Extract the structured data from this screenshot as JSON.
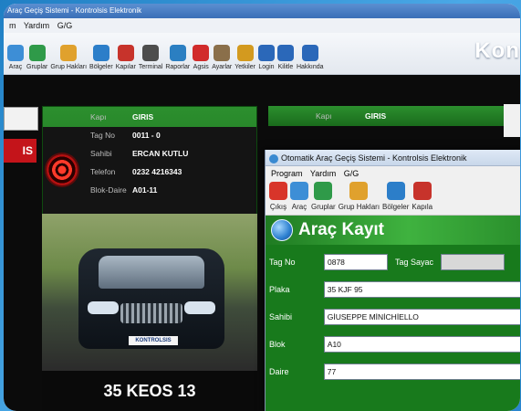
{
  "back_window": {
    "title": "Araç Geçiş Sistemi - Kontrolsis Elektronik",
    "menu": [
      "m",
      "Yardım",
      "G/G"
    ],
    "toolbar": [
      {
        "label": "Araç",
        "icon": "car-group-icon",
        "color": "#3d8ed6"
      },
      {
        "label": "Gruplar",
        "icon": "groups-icon",
        "color": "#2f9a49"
      },
      {
        "label": "Grup Hakları",
        "icon": "group-rights-icon",
        "color": "#e0a12d"
      },
      {
        "label": "Bölgeler",
        "icon": "regions-icon",
        "color": "#2c7ec9"
      },
      {
        "label": "Kapılar",
        "icon": "gates-icon",
        "color": "#c7332b"
      },
      {
        "label": "Terminal",
        "icon": "terminal-icon",
        "color": "#4d4d4d"
      },
      {
        "label": "Raporlar",
        "icon": "reports-icon",
        "color": "#2b7fc2"
      },
      {
        "label": "Agsis",
        "icon": "agsis-icon",
        "color": "#d12b2b"
      },
      {
        "label": "Ayarlar",
        "icon": "settings-icon",
        "color": "#8a6f4a"
      },
      {
        "label": "Yetkiler",
        "icon": "permissions-icon",
        "color": "#d39a1f"
      },
      {
        "label": "Login",
        "icon": "login-icon",
        "color": "#2b68b9"
      },
      {
        "label": "Kilitle",
        "icon": "lock-icon",
        "color": "#2b68b9"
      },
      {
        "label": "Hakkında",
        "icon": "info-icon",
        "color": "#2b68b9"
      }
    ],
    "brand": "Kon",
    "left_tag": "IS",
    "panel": {
      "kapi_label": "Kapı",
      "kapi_value": "GIRIS",
      "tag_label": "Tag No",
      "tag_value": "0011 - 0",
      "sahibi_label": "Sahibi",
      "sahibi_value": "ERCAN KUTLU",
      "telefon_label": "Telefon",
      "telefon_value": "0232 4216343",
      "blok_label": "Blok-Daire",
      "blok_value": "A01-11"
    },
    "plate_overlay": "KONTROLSIS",
    "plate_number": "35 KEOS 13",
    "right_panel": {
      "kapi_label": "Kapı",
      "kapi_value": "GIRIS"
    }
  },
  "front_window": {
    "title": "Otomatik Araç Geçiş Sistemi - Kontrolsis Elektronik",
    "menu": [
      "Program",
      "Yardım",
      "G/G"
    ],
    "toolbar": [
      {
        "label": "Çıkış",
        "icon": "power-icon",
        "color": "#d8352a"
      },
      {
        "label": "Araç",
        "icon": "car-group-icon",
        "color": "#3d8ed6"
      },
      {
        "label": "Gruplar",
        "icon": "groups-icon",
        "color": "#2f9a49"
      },
      {
        "label": "Grup Hakları",
        "icon": "group-rights-icon",
        "color": "#e0a12d"
      },
      {
        "label": "Bölgeler",
        "icon": "regions-icon",
        "color": "#2c7ec9"
      },
      {
        "label": "Kapıla",
        "icon": "gates-icon",
        "color": "#c7332b"
      }
    ],
    "banner": "Araç Kayıt",
    "form": {
      "tag_no_label": "Tag No",
      "tag_no_value": "0878",
      "tag_sayac_label": "Tag Sayac",
      "plaka_label": "Plaka",
      "plaka_value": "35 KJF 95",
      "sahibi_label": "Sahibi",
      "sahibi_value": "GİUSEPPE MİNİCHİELLO",
      "blok_label": "Blok",
      "blok_value": "A10",
      "daire_label": "Daire",
      "daire_value": "77"
    }
  }
}
